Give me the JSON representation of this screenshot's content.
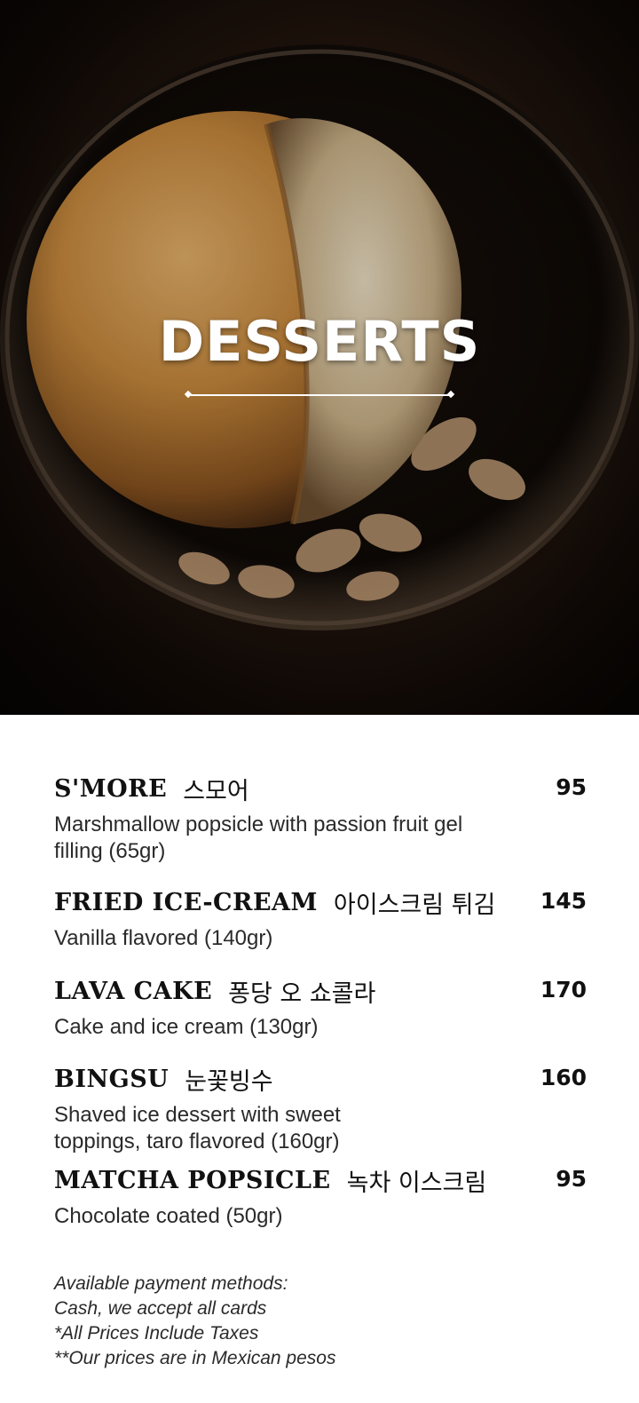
{
  "header": {
    "title": "DESSERTS"
  },
  "menu": {
    "items": [
      {
        "name": "S'MORE",
        "korean": "스모어",
        "price": "95",
        "description": "Marshmallow popsicle with passion fruit gel filling (65gr)"
      },
      {
        "name": "FRIED ICE-CREAM",
        "korean": "아이스크림 튀김",
        "price": "145",
        "description": "Vanilla flavored (140gr)"
      },
      {
        "name": "LAVA CAKE",
        "korean": "퐁당 오 쇼콜라",
        "price": "170",
        "description": "Cake and ice cream (130gr)"
      },
      {
        "name": "BINGSU",
        "korean": "눈꽃빙수",
        "price": "160",
        "description": "Shaved ice dessert with sweet toppings, taro flavored (160gr)"
      },
      {
        "name": "MATCHA POPSICLE",
        "korean": "녹차 이스크림",
        "price": "95",
        "description": "Chocolate coated (50gr)"
      }
    ]
  },
  "notes": [
    "Available payment methods:",
    "Cash, we accept all cards",
    "*All Prices Include Taxes",
    "**Our prices are in Mexican pesos"
  ]
}
